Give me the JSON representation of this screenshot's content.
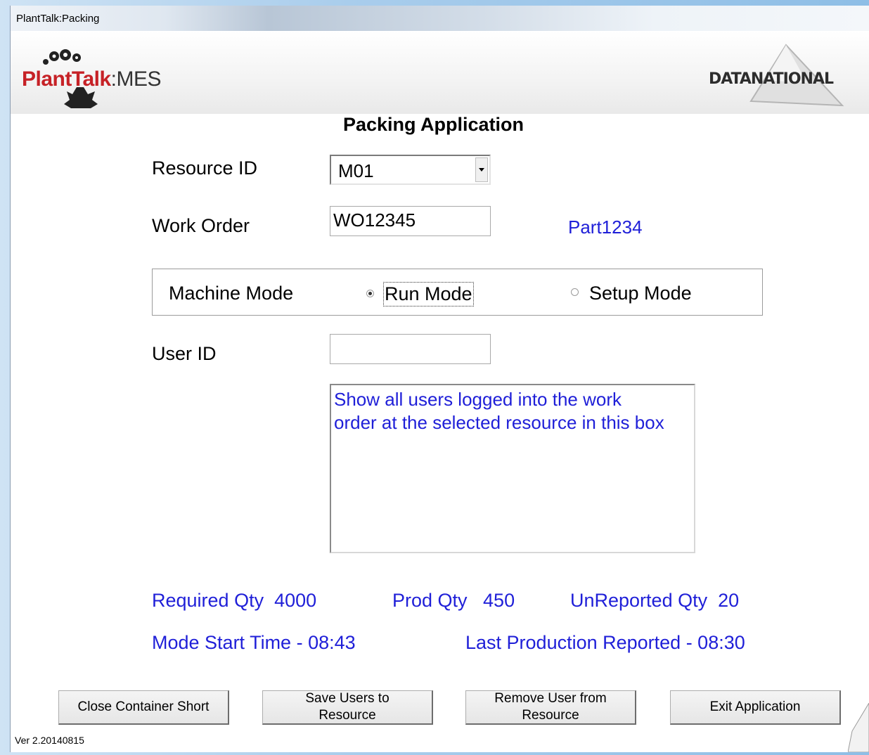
{
  "window": {
    "title": "PlantTalk:Packing"
  },
  "header": {
    "logo_brand": "PlantTalk",
    "logo_suffix": ":MES",
    "partner_logo": "DATANATIONAL"
  },
  "app_title": "Packing Application",
  "form": {
    "resource_label": "Resource ID",
    "resource_value": "M01",
    "work_order_label": "Work Order",
    "work_order_value": "WO12345",
    "part_number": "Part1234",
    "machine_mode_label": "Machine Mode",
    "run_mode_label": "Run Mode",
    "setup_mode_label": "Setup Mode",
    "selected_mode": "Run Mode",
    "user_id_label": "User ID",
    "user_id_value": "",
    "users_box_text": "Show all users logged into the work order at the selected resource in this box"
  },
  "stats": {
    "required_qty": "Required Qty  4000",
    "prod_qty": "Prod Qty   450",
    "unreported_qty": "UnReported Qty  20",
    "mode_start_time": "Mode Start Time - 08:43",
    "last_production": "Last Production Reported - 08:30"
  },
  "buttons": {
    "close_container_short": "Close Container Short",
    "save_users": "Save Users to Resource",
    "remove_user": "Remove User from Resource",
    "exit_app": "Exit Application"
  },
  "footer": {
    "version": "Ver 2.20140815"
  },
  "colors": {
    "accent_text": "#1f1fd8",
    "logo_red": "#c62126"
  }
}
